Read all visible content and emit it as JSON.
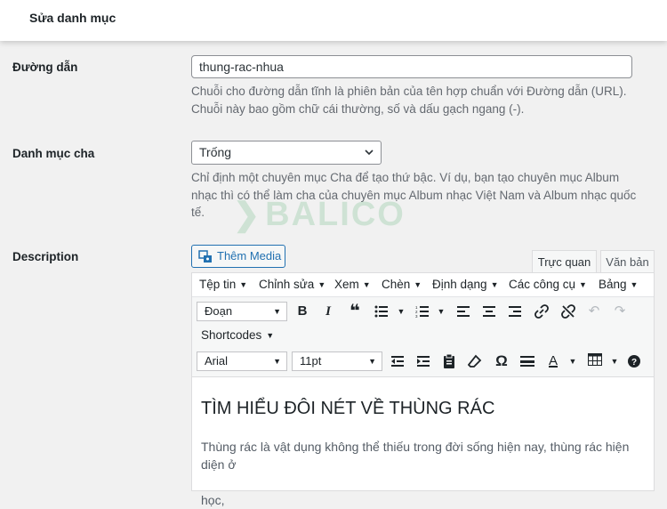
{
  "header": {
    "title": "Sửa danh mục"
  },
  "slug": {
    "label": "Đường dẫn",
    "value": "thung-rac-nhua",
    "help_line1": "Chuỗi cho đường dẫn tĩnh là phiên bản của tên hợp chuẩn với Đường dẫn (URL).",
    "help_line2": "Chuỗi này bao gồm chữ cái thường, số và dấu gạch ngang (-)."
  },
  "parent": {
    "label": "Danh mục cha",
    "selected": "Trống",
    "help_line1": "Chỉ định một chuyên mục Cha để tạo thứ bậc. Ví dụ, bạn tạo chuyên mục Album",
    "help_line2": "nhạc thì có thể làm cha của chuyên mục Album nhạc Việt Nam và Album nhạc quốc",
    "help_line3": "tế."
  },
  "watermark": {
    "text": "BALICO"
  },
  "description": {
    "label": "Description",
    "add_media": "Thêm Media",
    "tabs": [
      "Trực quan",
      "Văn bản"
    ]
  },
  "editor": {
    "menus": [
      "Tệp tin",
      "Chỉnh sửa",
      "Xem",
      "Chèn",
      "Định dạng",
      "Các công cụ",
      "Bảng"
    ],
    "format_select": "Đoạn",
    "shortcodes": "Shortcodes",
    "font_family": "Arial",
    "font_size": "11pt",
    "heading": "TÌM HIỂU ĐÔI NÉT VỀ THÙNG RÁC",
    "paragraph_line1": "Thùng rác là vật dụng không thể thiếu trong đời sống hiện nay, thùng rác hiện diện ở",
    "paragraph_line2": "khắp mọi nơi từ trong nhà ra ngoài ngõ, vỉa hè, công viên, nhà hàng, trường học,"
  },
  "colors": {
    "accent": "#2271b1",
    "watermark": "#1e9a45"
  }
}
